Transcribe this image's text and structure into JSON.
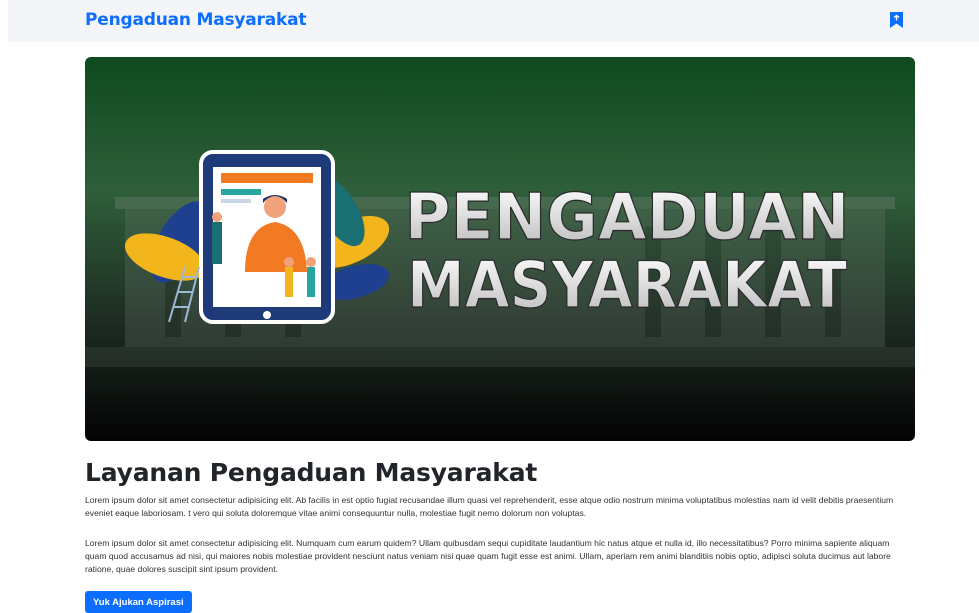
{
  "navbar": {
    "brand": "Pengaduan Masyarakat",
    "bookmark_icon": "bookmark-icon"
  },
  "hero": {
    "line1": "PENGADUAN",
    "line2": "MASYARAKAT",
    "illustration_icon": "tablet-people-illustration"
  },
  "main": {
    "title": "Layanan Pengaduan Masyarakat",
    "paragraph1": "Lorem ipsum dolor sit amet consectetur adipisicing elit. Ab facilis in est optio fugiat recusandae illum quasi vel reprehenderit, esse atque odio nostrum minima voluptatibus molestias nam id velit debitis praesentium eveniet eaque laboriosam. t vero qui soluta doloremque vitae animi consequuntur nulla, molestiae fugit nemo dolorum non voluptas.",
    "paragraph2": "Lorem ipsum dolor sit amet consectetur adipisicing elit. Numquam cum earum quidem? Ullam quibusdam sequi cupiditate laudantium hic natus atque et nulla id, illo necessitatibus? Porro minima sapiente aliquam quam quod accusamus ad nisi, qui maiores nobis molestiae provident nesciunt natus veniam nisi quae quam fugit esse est animi. Ullam, aperiam rem animi blanditiis nobis optio, adipisci soluta ducimus aut labore ratione, quae dolores suscipit sint ipsum provident.",
    "cta_label": "Yuk Ajukan Aspirasi"
  },
  "colors": {
    "primary": "#0d6efd",
    "navbar_bg": "#f3f5f8",
    "hero_green": "#1f5a2c"
  }
}
